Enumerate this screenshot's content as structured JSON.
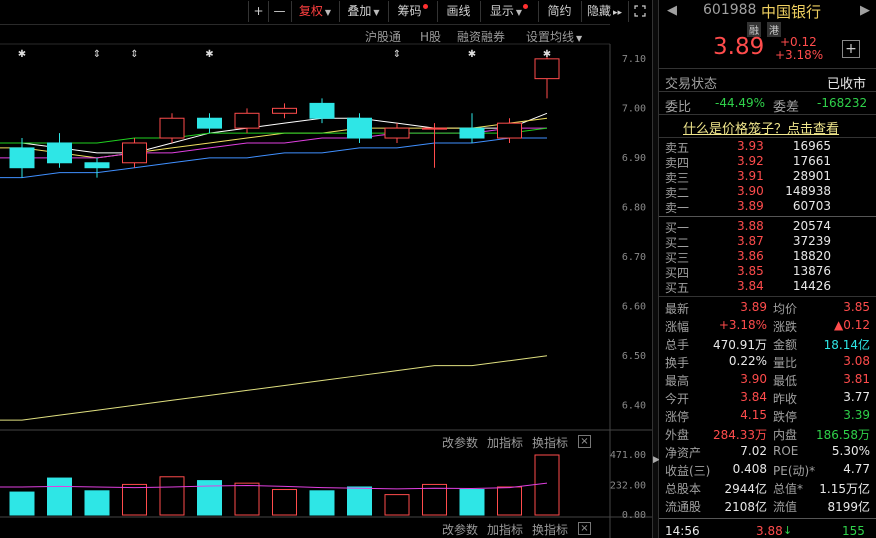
{
  "toolbar": {
    "plus": "+",
    "minus": "—",
    "adjust": "复权",
    "overlay": "叠加",
    "chips": "筹码",
    "draw": "画线",
    "display": "显示",
    "simple": "简约",
    "hide": "隐藏",
    "more": "▸▸",
    "fullscreen_icon": "expand-icon"
  },
  "subbar": {
    "hk_connect": "沪股通",
    "h_share": "H股",
    "margin": "融资融券",
    "ma_settings": "设置均线"
  },
  "price_axis": [
    "7.10",
    "7.00",
    "6.90",
    "6.80",
    "6.70",
    "6.60",
    "6.50",
    "6.40"
  ],
  "volume_axis": [
    "471.00",
    "232.00",
    "0.00"
  ],
  "panel_buttons": {
    "params": "改参数",
    "add_indicator": "加指标",
    "switch_indicator": "换指标",
    "close": "×"
  },
  "colors": {
    "up": "#ff4c4c",
    "down": "#2ee6e6",
    "ma5": "#ffffff",
    "ma10": "#f0e060",
    "ma20": "#e040e0",
    "ma30": "#20d020",
    "ma60": "#4090ff",
    "ma120": "#e0e080"
  },
  "chart_data": {
    "type": "candlestick",
    "ylim": [
      6.35,
      7.13
    ],
    "candles": [
      {
        "o": 6.92,
        "c": 6.88,
        "h": 6.94,
        "l": 6.86
      },
      {
        "o": 6.93,
        "c": 6.89,
        "h": 6.95,
        "l": 6.88
      },
      {
        "o": 6.89,
        "c": 6.88,
        "h": 6.9,
        "l": 6.86
      },
      {
        "o": 6.89,
        "c": 6.93,
        "h": 6.94,
        "l": 6.88
      },
      {
        "o": 6.94,
        "c": 6.98,
        "h": 6.99,
        "l": 6.93
      },
      {
        "o": 6.98,
        "c": 6.96,
        "h": 6.99,
        "l": 6.95
      },
      {
        "o": 6.96,
        "c": 6.99,
        "h": 7.0,
        "l": 6.95
      },
      {
        "o": 6.99,
        "c": 7.0,
        "h": 7.01,
        "l": 6.98
      },
      {
        "o": 7.01,
        "c": 6.98,
        "h": 7.02,
        "l": 6.97
      },
      {
        "o": 6.98,
        "c": 6.94,
        "h": 6.99,
        "l": 6.93
      },
      {
        "o": 6.94,
        "c": 6.96,
        "h": 6.97,
        "l": 6.93
      },
      {
        "o": 6.96,
        "c": 6.96,
        "h": 6.97,
        "l": 6.88
      },
      {
        "o": 6.96,
        "c": 6.94,
        "h": 6.99,
        "l": 6.93
      },
      {
        "o": 6.94,
        "c": 6.97,
        "h": 6.98,
        "l": 6.93
      },
      {
        "o": 7.06,
        "c": 7.1,
        "h": 7.11,
        "l": 7.02
      }
    ],
    "markers": [
      "✱",
      "",
      "⇕",
      "⇕",
      "",
      "✱",
      "",
      "",
      "",
      "",
      "⇕",
      "",
      "✱",
      "",
      "✱"
    ],
    "volumes": [
      180,
      290,
      190,
      240,
      300,
      270,
      250,
      200,
      190,
      220,
      160,
      240,
      200,
      220,
      471
    ],
    "volume_ylim": [
      0,
      471
    ],
    "ma_series": [
      {
        "color": "#ffffff",
        "values": [
          6.93,
          6.92,
          6.91,
          6.91,
          6.93,
          6.95,
          6.96,
          6.97,
          6.98,
          6.98,
          6.97,
          6.96,
          6.96,
          6.96,
          6.99
        ]
      },
      {
        "color": "#f0e060",
        "values": [
          6.92,
          6.91,
          6.9,
          6.91,
          6.92,
          6.93,
          6.94,
          6.95,
          6.95,
          6.96,
          6.96,
          6.96,
          6.96,
          6.97,
          6.98
        ]
      },
      {
        "color": "#e040e0",
        "values": [
          6.9,
          6.9,
          6.9,
          6.91,
          6.91,
          6.92,
          6.93,
          6.93,
          6.94,
          6.94,
          6.95,
          6.95,
          6.95,
          6.96,
          6.96
        ]
      },
      {
        "color": "#20d020",
        "values": [
          6.93,
          6.93,
          6.93,
          6.94,
          6.94,
          6.95,
          6.95,
          6.95,
          6.95,
          6.95,
          6.95,
          6.95,
          6.95,
          6.95,
          6.96
        ]
      },
      {
        "color": "#4090ff",
        "values": [
          6.86,
          6.87,
          6.87,
          6.88,
          6.89,
          6.9,
          6.9,
          6.91,
          6.91,
          6.92,
          6.92,
          6.93,
          6.93,
          6.94,
          6.94
        ]
      },
      {
        "color": "#e0e080",
        "values": [
          6.37,
          6.38,
          6.39,
          6.4,
          6.41,
          6.42,
          6.43,
          6.44,
          6.45,
          6.46,
          6.47,
          6.48,
          6.48,
          6.49,
          6.5
        ]
      }
    ],
    "volume_ma": [
      220,
      225,
      220,
      215,
      220,
      228,
      232,
      225,
      215,
      210,
      205,
      210,
      208,
      215,
      250
    ]
  },
  "quote": {
    "code": "601988",
    "name": "中国银行",
    "tag_margin": "融",
    "tag_hk": "港",
    "price": "3.89",
    "change": "+0.12",
    "change_pct": "+3.18%",
    "add_icon": "+",
    "status_label": "交易状态",
    "status_value": "已收市",
    "ratio_label": "委比",
    "ratio_value": "-44.49%",
    "diff_label": "委差",
    "diff_value": "-168232",
    "cage_link": "什么是价格笼子？点击查看",
    "asks": [
      {
        "label": "卖五",
        "price": "3.93",
        "vol": "16965"
      },
      {
        "label": "卖四",
        "price": "3.92",
        "vol": "17661"
      },
      {
        "label": "卖三",
        "price": "3.91",
        "vol": "28901"
      },
      {
        "label": "卖二",
        "price": "3.90",
        "vol": "148938"
      },
      {
        "label": "卖一",
        "price": "3.89",
        "vol": "60703"
      }
    ],
    "bids": [
      {
        "label": "买一",
        "price": "3.88",
        "vol": "20574"
      },
      {
        "label": "买二",
        "price": "3.87",
        "vol": "37239"
      },
      {
        "label": "买三",
        "price": "3.86",
        "vol": "18820"
      },
      {
        "label": "买四",
        "price": "3.85",
        "vol": "13876"
      },
      {
        "label": "买五",
        "price": "3.84",
        "vol": "14426"
      }
    ],
    "stats": [
      {
        "l1": "最新",
        "v1": "3.89",
        "c1": "red",
        "l2": "均价",
        "v2": "3.85",
        "c2": "red"
      },
      {
        "l1": "涨幅",
        "v1": "+3.18%",
        "c1": "red",
        "l2": "涨跌",
        "v2": "▲0.12",
        "c2": "red"
      },
      {
        "l1": "总手",
        "v1": "470.91万",
        "c1": "white",
        "l2": "金额",
        "v2": "18.14亿",
        "c2": "cyan"
      },
      {
        "l1": "换手",
        "v1": "0.22%",
        "c1": "white",
        "l2": "量比",
        "v2": "3.08",
        "c2": "red"
      },
      {
        "l1": "最高",
        "v1": "3.90",
        "c1": "red",
        "l2": "最低",
        "v2": "3.81",
        "c2": "red"
      },
      {
        "l1": "今开",
        "v1": "3.84",
        "c1": "red",
        "l2": "昨收",
        "v2": "3.77",
        "c2": "white"
      },
      {
        "l1": "涨停",
        "v1": "4.15",
        "c1": "red",
        "l2": "跌停",
        "v2": "3.39",
        "c2": "green"
      },
      {
        "l1": "外盘",
        "v1": "284.33万",
        "c1": "red",
        "l2": "内盘",
        "v2": "186.58万",
        "c2": "green"
      },
      {
        "l1": "净资产",
        "v1": "7.02",
        "c1": "white",
        "l2": "ROE",
        "v2": "5.30%",
        "c2": "white"
      },
      {
        "l1": "收益(三)",
        "v1": "0.408",
        "c1": "white",
        "l2": "PE(动)*",
        "v2": "4.77",
        "c2": "white"
      },
      {
        "l1": "总股本",
        "v1": "2944亿",
        "c1": "white",
        "l2": "总值*",
        "v2": "1.15万亿",
        "c2": "white"
      },
      {
        "l1": "流通股",
        "v1": "2108亿",
        "c1": "white",
        "l2": "流值",
        "v2": "8199亿",
        "c2": "white"
      }
    ],
    "tick": {
      "time": "14:56",
      "price": "3.88",
      "vol": "155"
    }
  }
}
